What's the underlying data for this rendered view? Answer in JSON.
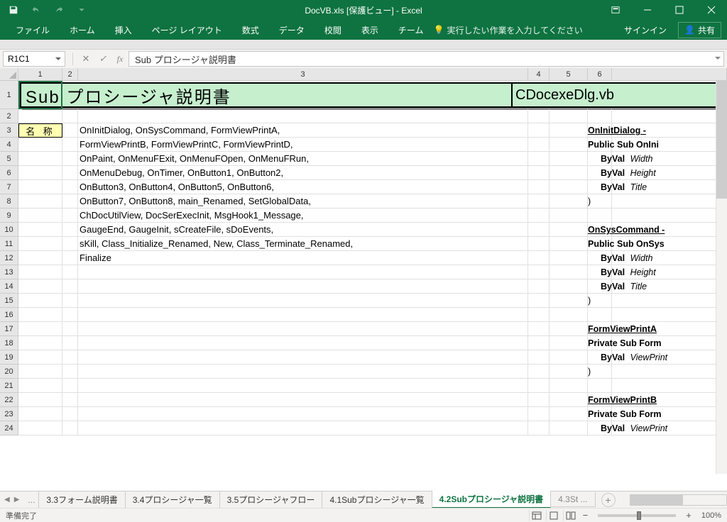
{
  "titlebar": {
    "title": "DocVB.xls [保護ビュー] - Excel"
  },
  "ribbon": {
    "tabs": [
      "ファイル",
      "ホーム",
      "挿入",
      "ページ レイアウト",
      "数式",
      "データ",
      "校閲",
      "表示",
      "チーム"
    ],
    "tell_me": "実行したい作業を入力してください",
    "signin": "サインイン",
    "share": "共有"
  },
  "formula_bar": {
    "name_box": "R1C1",
    "formula": "Sub プロシージャ説明書"
  },
  "columns": [
    "1",
    "2",
    "3",
    "4",
    "5",
    "6"
  ],
  "rows": {
    "r1_title": "Sub プロシージャ説明書",
    "r1_title2": "CDocexeDlg.vb",
    "r3_label": "名 称",
    "r3": "OnInitDialog, OnSysCommand, FormViewPrintA,",
    "r4": "FormViewPrintB, FormViewPrintC, FormViewPrintD,",
    "r5": "OnPaint, OnMenuFExit, OnMenuFOpen, OnMenuFRun,",
    "r6": "OnMenuDebug, OnTimer, OnButton1, OnButton2,",
    "r7": "OnButton3, OnButton4, OnButton5, OnButton6,",
    "r8": "OnButton7, OnButton8, main_Renamed, SetGlobalData,",
    "r9": "ChDocUtilView, DocSerExecInit, MsgHook1_Message,",
    "r10": "GaugeEnd, GaugeInit, sCreateFile, sDoEvents,",
    "r11": "sKill, Class_Initialize_Renamed, New, Class_Terminate_Renamed,",
    "r12": "Finalize"
  },
  "right_panel": {
    "b1_head": "OnInitDialog - ",
    "b1_sig": "Public Sub OnIni",
    "p_width_lbl": "ByVal",
    "p_width": "Width",
    "p_height_lbl": "ByVal",
    "p_height": "Height",
    "p_title_lbl": "ByVal",
    "p_title": "Title",
    "close_paren": ")",
    "b2_head": "OnSysCommand - ",
    "b2_sig": "Public Sub OnSys",
    "b3_head": "FormViewPrintA ",
    "b3_sig": "Private Sub Form",
    "p_vp_lbl": "ByVal",
    "p_vp": "ViewPrint",
    "b4_head": "FormViewPrintB ",
    "b4_sig": "Private Sub Form"
  },
  "sheet_tabs": {
    "nav_more": "...",
    "tabs": [
      "3.3フォーム説明書",
      "3.4プロシージャ一覧",
      "3.5プロシージャフロー",
      "4.1Subプロシージャ一覧",
      "4.2Subプロシージャ説明書",
      "4.3St ..."
    ],
    "active_index": 4
  },
  "status": {
    "ready": "準備完了",
    "zoom": "100%"
  }
}
